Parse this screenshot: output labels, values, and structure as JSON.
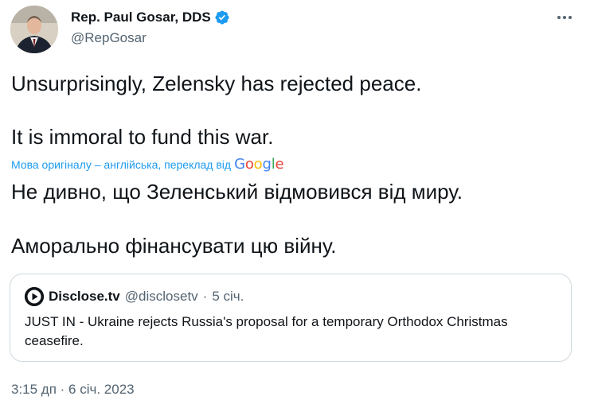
{
  "author": {
    "name": "Rep. Paul Gosar, DDS",
    "handle": "@RepGosar",
    "verified_icon": "verified-badge-icon"
  },
  "tweet": {
    "line1": "Unsurprisingly, Zelensky has rejected peace.",
    "line2": "It is immoral to fund this war.",
    "translation_note": "Мова оригіналу – англійська, переклад від",
    "translation_provider": "Google",
    "translated_line1": "Не дивно, що Зеленський відмовився від миру.",
    "translated_line2": "Аморально фінансувати цю війну."
  },
  "quoted_tweet": {
    "name": "Disclose.tv",
    "handle": "@disclosetv",
    "separator": "·",
    "date": "5 січ.",
    "text": "JUST IN - Ukraine rejects Russia's proposal for a temporary Orthodox Christmas ceasefire."
  },
  "timestamp": "3:15 дп · 6 січ. 2023",
  "colors": {
    "accent": "#1d9bf0",
    "text": "#0f1419",
    "secondary": "#536471",
    "border": "#cfd9de"
  }
}
